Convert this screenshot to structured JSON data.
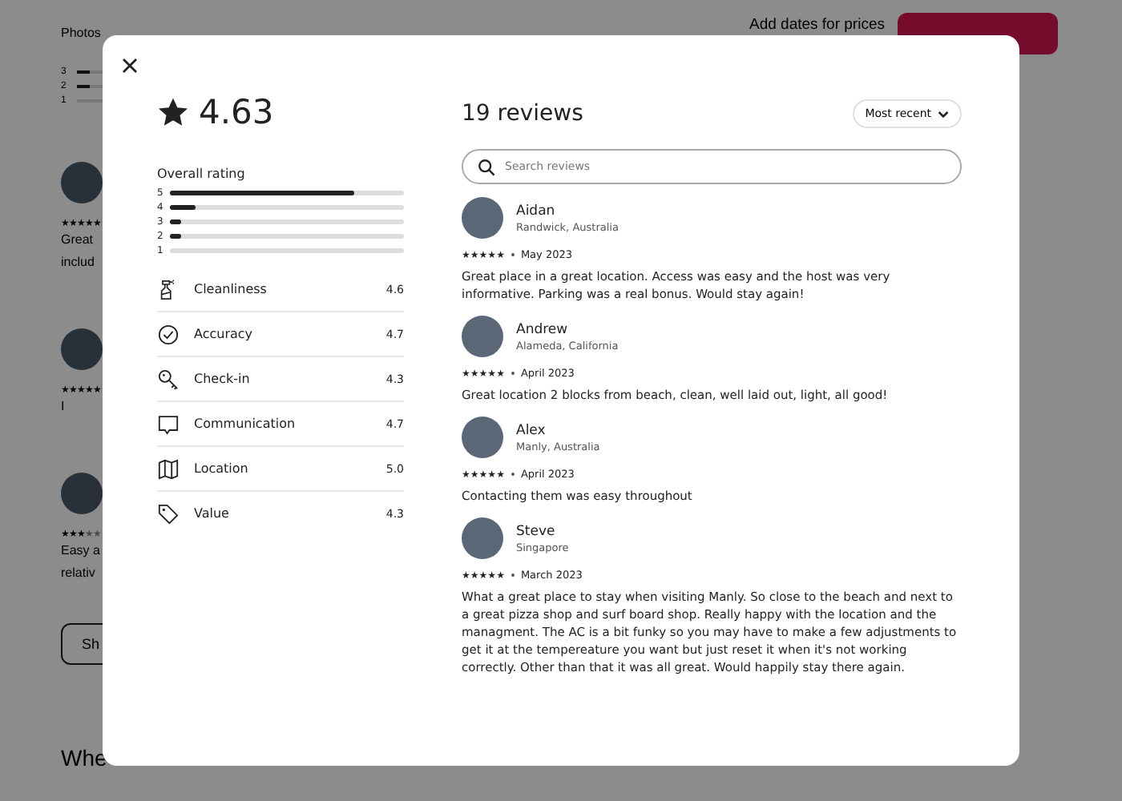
{
  "page": {
    "nav_tabs": [
      "Photos"
    ],
    "price_hint": "Add dates for prices",
    "rating_rows": [
      {
        "label": "3",
        "level": 0.1
      },
      {
        "label": "2",
        "level": 0.1
      },
      {
        "label": "1",
        "level": 0
      }
    ],
    "reviews": [
      {
        "lines": [
          "Great",
          "includ"
        ],
        "stars": 5
      },
      {
        "lines": [
          "I"
        ],
        "stars": 5
      },
      {
        "lines": [
          "Easy a",
          "relativ"
        ],
        "stars": 3
      }
    ],
    "show_button": "Sh",
    "section_heading": "Whe"
  },
  "modal": {
    "rating": "4.63",
    "overall_label": "Overall rating",
    "distribution": [
      {
        "label": "5",
        "level": 0.79
      },
      {
        "label": "4",
        "level": 0.11
      },
      {
        "label": "3",
        "level": 0.045
      },
      {
        "label": "2",
        "level": 0.045
      },
      {
        "label": "1",
        "level": 0
      }
    ],
    "categories": [
      {
        "kind": "cleanliness",
        "label": "Cleanliness",
        "score": "4.6"
      },
      {
        "kind": "accuracy",
        "label": "Accuracy",
        "score": "4.7"
      },
      {
        "kind": "checkin",
        "label": "Check-in",
        "score": "4.3"
      },
      {
        "kind": "communication",
        "label": "Communication",
        "score": "4.7"
      },
      {
        "kind": "location",
        "label": "Location",
        "score": "5.0"
      },
      {
        "kind": "value",
        "label": "Value",
        "score": "4.3"
      }
    ],
    "reviews_title": "19 reviews",
    "sort": "Most recent",
    "search": {
      "placeholder": "Search reviews"
    },
    "reviews": [
      {
        "name": "Aidan",
        "place": "Randwick, Australia",
        "stars": 5,
        "date": "May 2023",
        "text": "Great place in a great location. Access was easy and the host was very informative. Parking was a real bonus. Would stay again!"
      },
      {
        "name": "Andrew",
        "place": "Alameda, California",
        "stars": 5,
        "date": "April 2023",
        "text": "Great location 2 blocks from beach, clean, well laid out, light, all good!"
      },
      {
        "name": "Alex",
        "place": "Manly, Australia",
        "stars": 5,
        "date": "April 2023",
        "text": "Contacting them was easy throughout"
      },
      {
        "name": "Steve",
        "place": "Singapore",
        "stars": 5,
        "date": "March 2023",
        "text": "What a great place to stay when visiting Manly. So close to the beach and next to a great pizza shop and surf board shop. Really happy with the location and the managment. The AC is a bit funky so you may have to make a few adjustments to get it at the tempereature you want but just reset it when it's not working correctly. Other than that it was all great. Would happily stay there again."
      }
    ]
  }
}
